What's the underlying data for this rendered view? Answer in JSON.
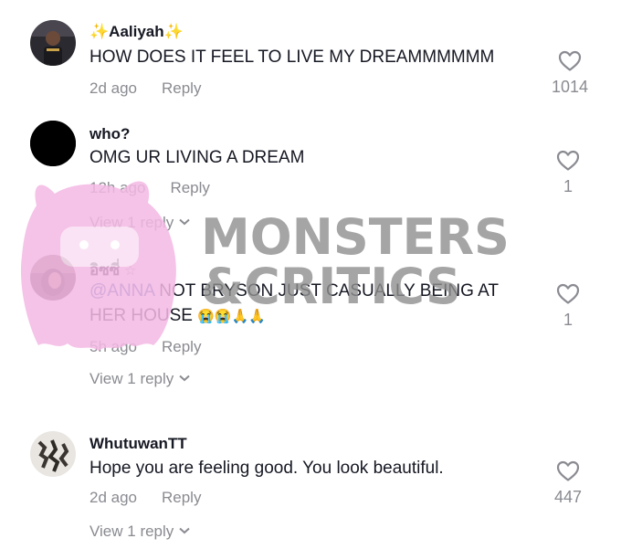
{
  "comments": [
    {
      "username": "Aaliyah",
      "username_prefix": "✨",
      "username_suffix": "✨",
      "text": "HOW DOES IT FEEL TO LIVE MY DREAMMMMMM",
      "time": "2d ago",
      "reply_label": "Reply",
      "like_count": "1014",
      "avatar_icon": "person-photo-icon"
    },
    {
      "username": "who?",
      "text": "OMG UR LIVING A DREAM",
      "time": "12h ago",
      "reply_label": "Reply",
      "like_count": "1",
      "view_replies": "View 1 reply",
      "avatar_icon": "black-circle-avatar"
    },
    {
      "username": "อิซซี่",
      "username_suffix": "☆",
      "mention": "@ANNA",
      "text_line1": " NOT BRYSON JUST CASUALLY BEING AT",
      "text_line2": "HER HOUSE",
      "text_emoji": "😭😭🙏🙏",
      "time": "5h ago",
      "reply_label": "Reply",
      "like_count": "1",
      "view_replies": "View 1 reply",
      "avatar_icon": "person-photo-icon"
    },
    {
      "username": "WhutuwanTT",
      "text": "Hope you are feeling good. You look beautiful.",
      "time": "2d ago",
      "reply_label": "Reply",
      "like_count": "447",
      "view_replies": "View 1 reply",
      "avatar_icon": "group-photo-icon"
    }
  ],
  "watermark": {
    "line1": "MONSTERS",
    "line2": "&CRITICS",
    "logo_color": "#f4b8e4",
    "text_color": "#8f8f8f"
  }
}
